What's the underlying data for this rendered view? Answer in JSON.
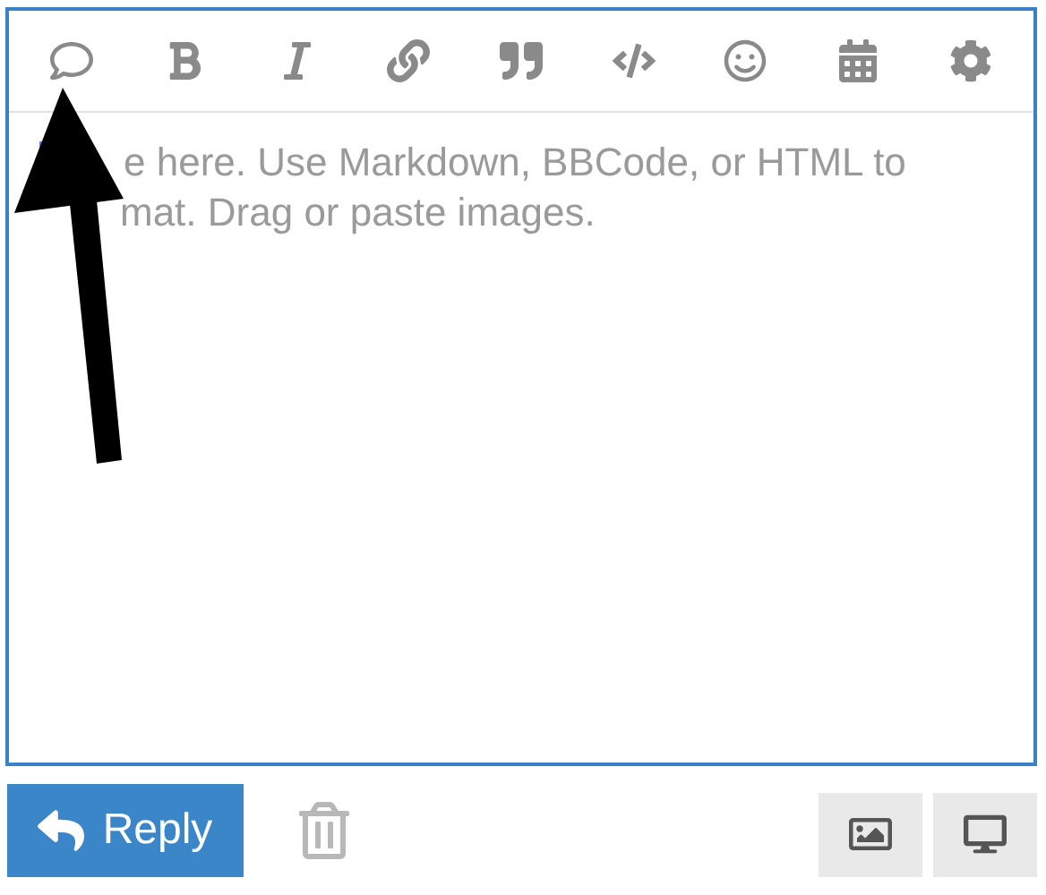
{
  "editor": {
    "placeholder_lines": [
      "e here. Use Markdown, BBCode, or HTML to",
      "mat. Drag or paste images."
    ]
  },
  "footer": {
    "reply_button": "Reply"
  }
}
